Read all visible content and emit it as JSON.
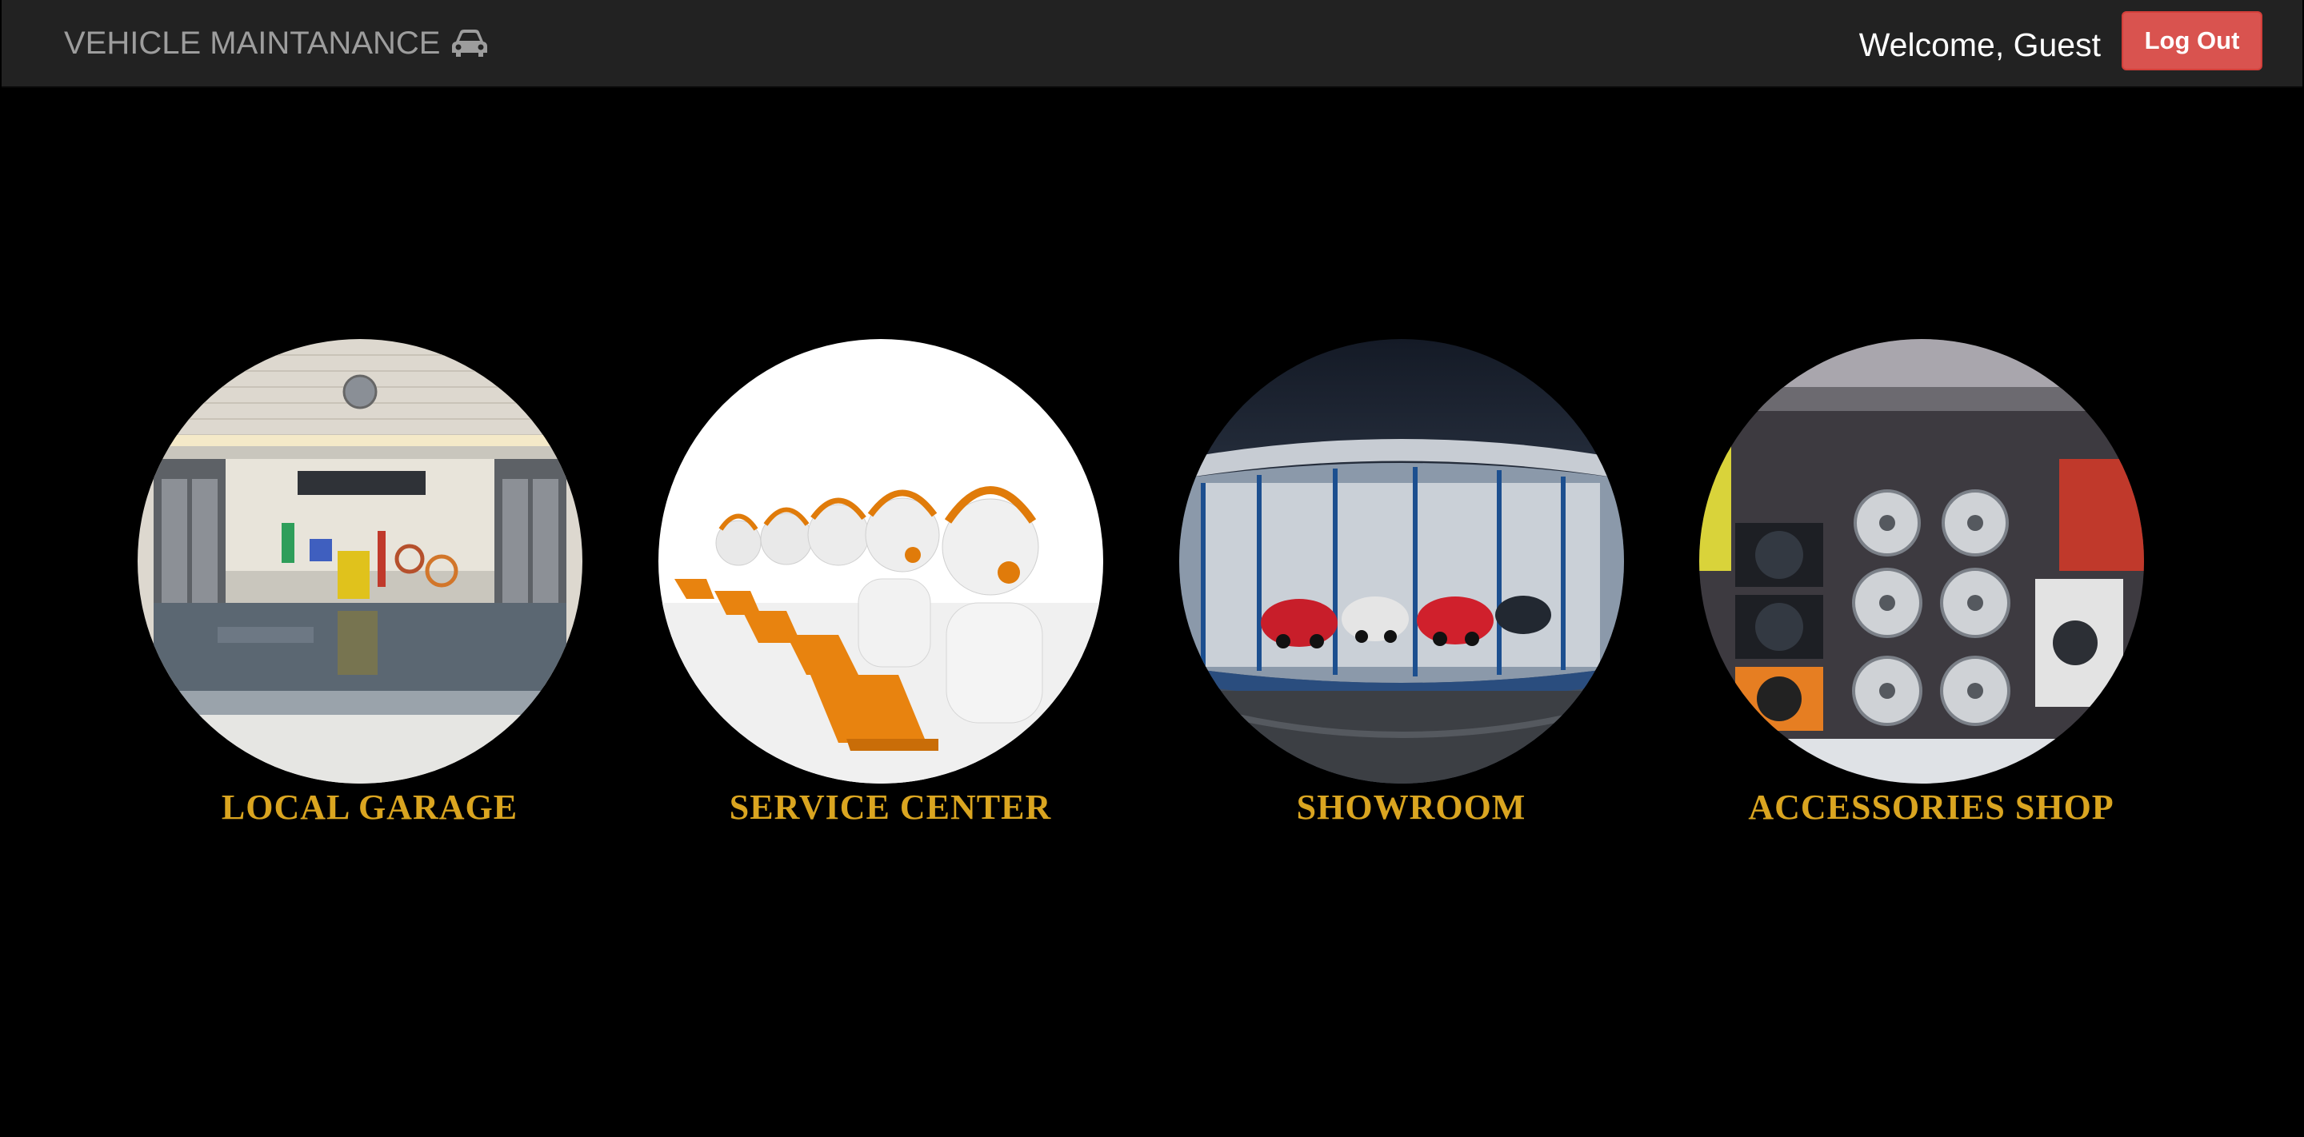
{
  "navbar": {
    "brand_label": "VEHICLE MAINTANANCE",
    "brand_icon": "car-icon",
    "welcome_text": "Welcome, Guest",
    "logout_label": "Log Out"
  },
  "services": [
    {
      "label": "LOCAL GARAGE",
      "image": "garage-photo"
    },
    {
      "label": "SERVICE CENTER",
      "image": "call-center-illustration"
    },
    {
      "label": "SHOWROOM",
      "image": "car-showroom-photo"
    },
    {
      "label": "ACCESSORIES SHOP",
      "image": "wheels-shop-photo"
    }
  ],
  "colors": {
    "navbar_bg": "#222222",
    "page_bg": "#000000",
    "caption": "#daa520",
    "logout": "#d9534f"
  }
}
